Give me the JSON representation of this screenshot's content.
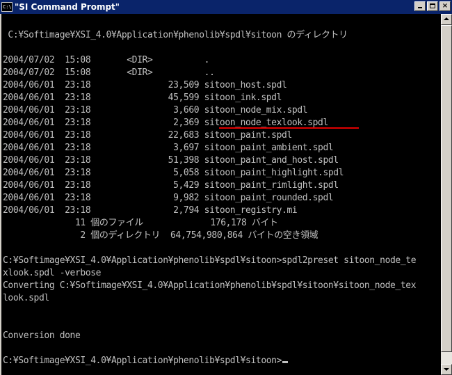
{
  "window": {
    "title": "\"SI Command Prompt\"",
    "icon_text": "C:\\"
  },
  "console": {
    "lines": [
      "",
      " C:¥Softimage¥XSI_4.0¥Application¥phenolib¥spdl¥sitoon のディレクトリ",
      "",
      "2004/07/02  15:08       <DIR>          .",
      "2004/07/02  15:08       <DIR>          ..",
      "2004/06/01  23:18               23,509 sitoon_host.spdl",
      "2004/06/01  23:18               45,599 sitoon_ink.spdl",
      "2004/06/01  23:18                3,660 sitoon_node_mix.spdl",
      "2004/06/01  23:18                2,369 sitoon_node_texlook.spdl",
      "2004/06/01  23:18               22,683 sitoon_paint.spdl",
      "2004/06/01  23:18                3,697 sitoon_paint_ambient.spdl",
      "2004/06/01  23:18               51,398 sitoon_paint_and_host.spdl",
      "2004/06/01  23:18                5,058 sitoon_paint_highlight.spdl",
      "2004/06/01  23:18                5,429 sitoon_paint_rimlight.spdl",
      "2004/06/01  23:18                9,982 sitoon_paint_rounded.spdl",
      "2004/06/01  23:18                2,794 sitoon_registry.mi",
      "              11 個のファイル             176,178 バイト",
      "               2 個のディレクトリ  64,754,980,864 バイトの空き領域",
      "",
      "C:¥Softimage¥XSI_4.0¥Application¥phenolib¥spdl¥sitoon>spdl2preset sitoon_node_te",
      "xlook.spdl -verbose",
      "Converting C:¥Softimage¥XSI_4.0¥Application¥phenolib¥spdl¥sitoon¥sitoon_node_tex",
      "look.spdl",
      "",
      "",
      "Conversion done",
      "",
      "C:¥Softimage¥XSI_4.0¥Application¥phenolib¥spdl¥sitoon>"
    ]
  },
  "colors": {
    "text": "#c0c0c0",
    "background": "#000000",
    "titlebar": "#0a246a",
    "highlight_underline": "#e00000"
  }
}
